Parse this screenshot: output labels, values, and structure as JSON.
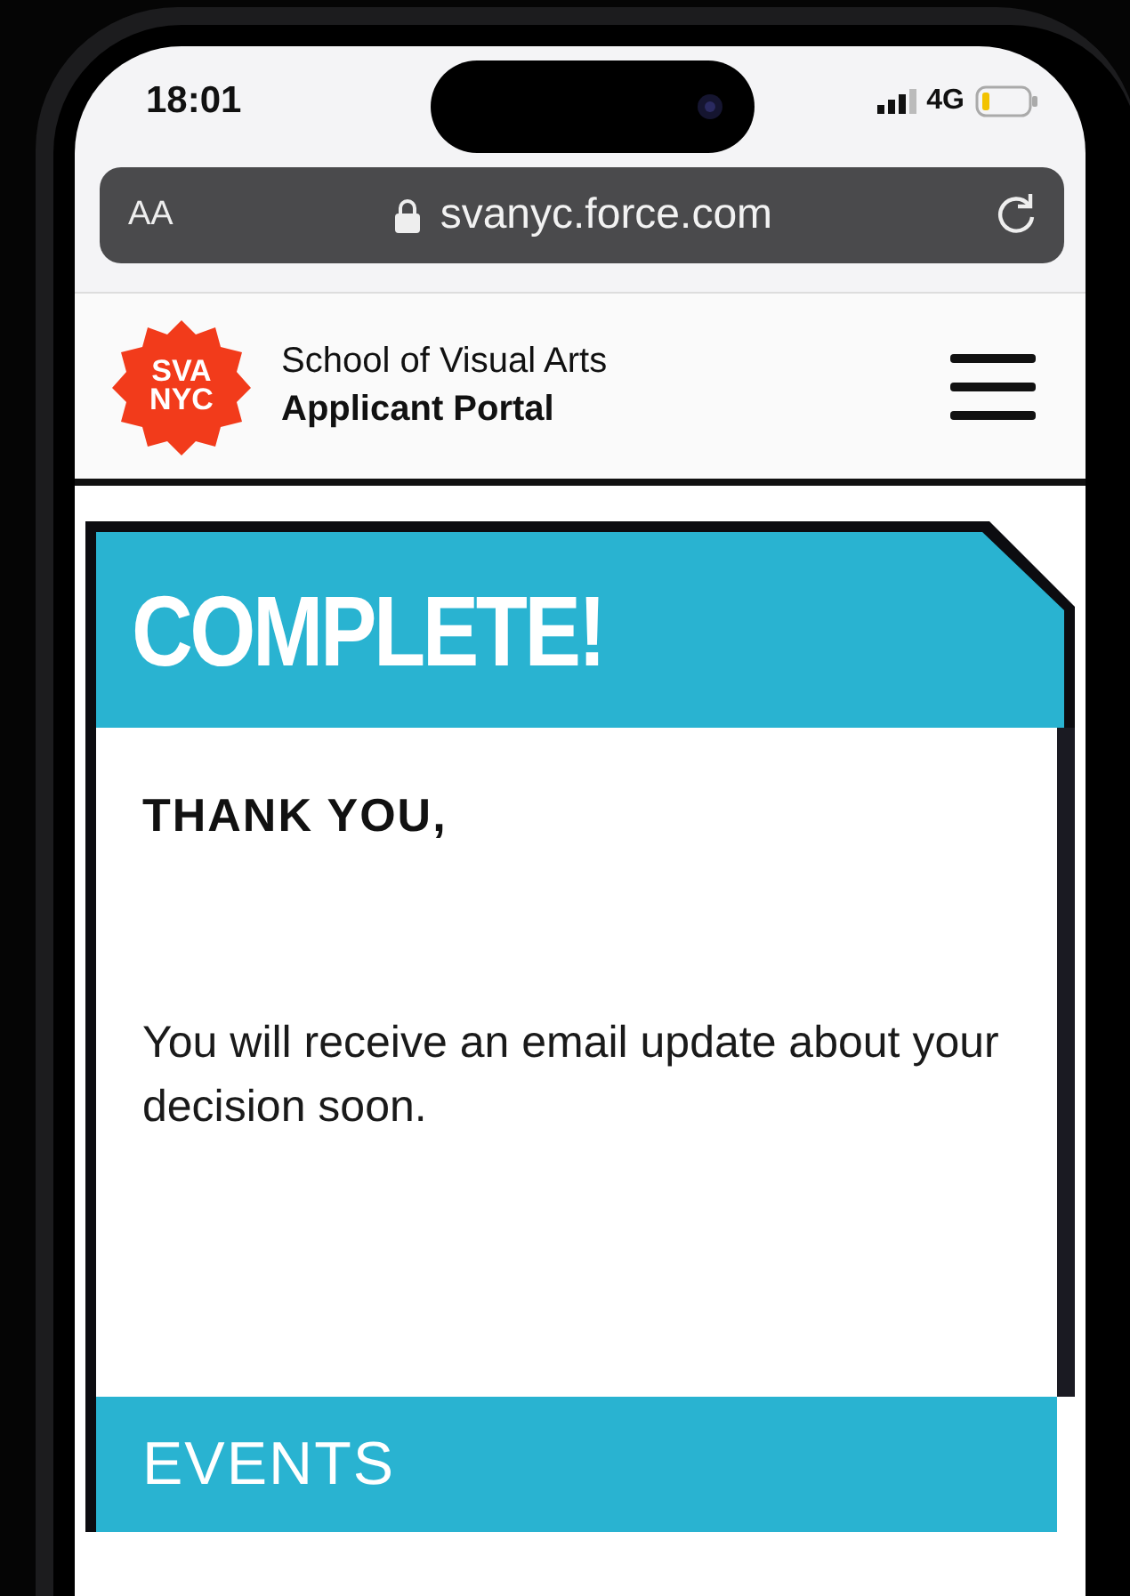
{
  "status_bar": {
    "time": "18:01",
    "network": "4G"
  },
  "browser_bar": {
    "text_size_button": "AA",
    "url": "svanyc.force.com"
  },
  "header": {
    "logo": [
      "SVA",
      "NYC"
    ],
    "title": "School of Visual Arts",
    "subtitle": "Applicant Portal"
  },
  "complete_card": {
    "heading": "COMPLETE!",
    "greeting": "THANK YOU,",
    "message": "You will receive an email update about your decision soon."
  },
  "events": {
    "heading": "EVENTS"
  }
}
